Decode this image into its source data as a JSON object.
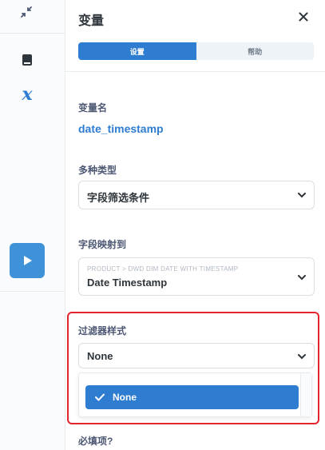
{
  "panel": {
    "title": "变量",
    "tabs": [
      {
        "label": "设置",
        "active": true
      },
      {
        "label": "帮助",
        "active": false
      }
    ]
  },
  "variable_name": {
    "label": "变量名",
    "value": "date_timestamp"
  },
  "variable_type": {
    "label": "多种类型",
    "value": "字段筛选条件"
  },
  "field_mapping": {
    "label": "字段映射到",
    "table_path": "PRODUCT > DWD DIM DATE WITH TIMESTAMP",
    "value": "Date Timestamp"
  },
  "filter_widget": {
    "label": "过滤器样式",
    "value": "None",
    "options": [
      {
        "label": "None",
        "selected": true
      }
    ]
  },
  "required": {
    "label": "必填项?"
  },
  "colors": {
    "accent": "#2e7dd1",
    "highlight": "#e3262e"
  },
  "icons": {
    "collapse": "collapse-icon",
    "book": "book-icon",
    "variable": "variable-x-icon",
    "run": "play-icon",
    "close": "close-icon",
    "dropdown": "chevron-down-icon",
    "check": "check-icon"
  }
}
